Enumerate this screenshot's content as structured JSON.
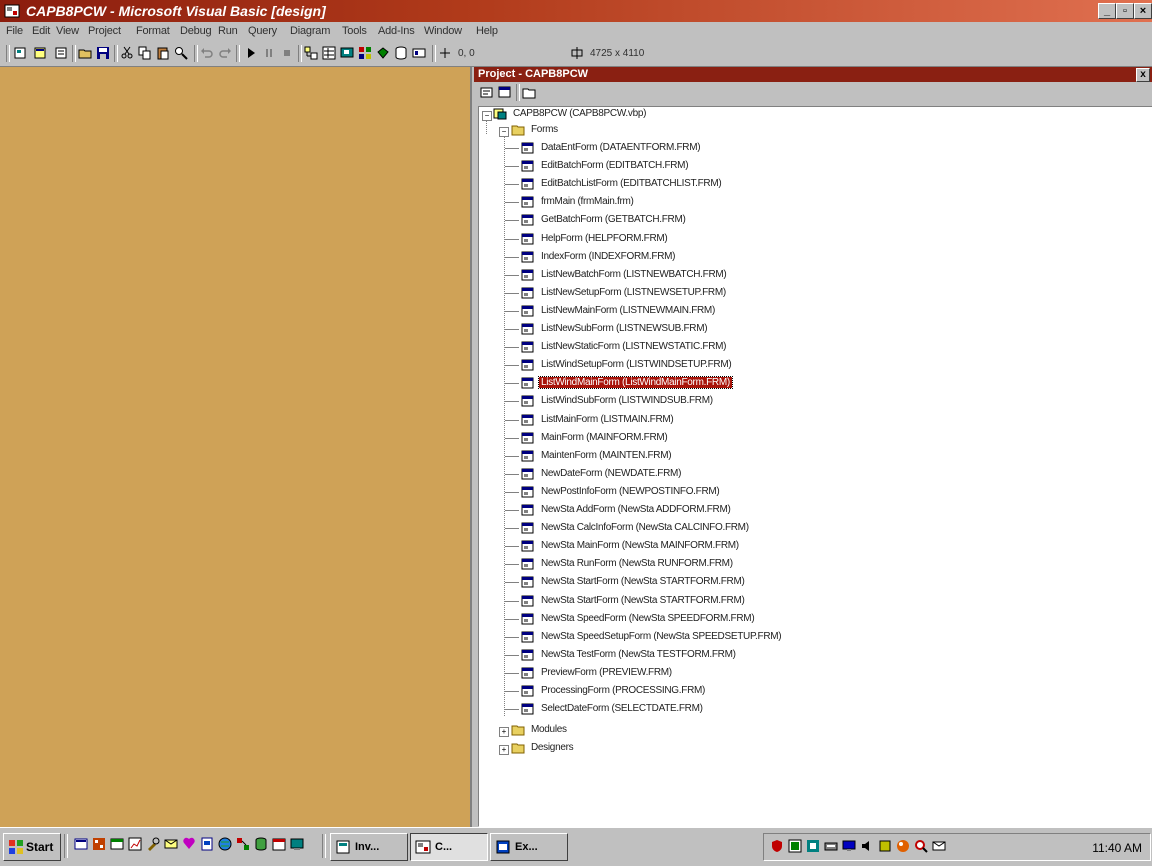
{
  "window": {
    "title": "CAPB8PCW - Microsoft Visual Basic [design]",
    "controls": {
      "minimize": "_",
      "restore": "▫",
      "close": "×"
    }
  },
  "menu": [
    "File",
    "Edit",
    "View",
    "Project",
    "Format",
    "Debug",
    "Run",
    "Query",
    "Diagram",
    "Tools",
    "Add-Ins",
    "Window",
    "Help"
  ],
  "toolbar": {
    "position": "0, 0",
    "size": "4725 x 4110"
  },
  "project": {
    "title": "Project - CAPB8PCW",
    "close": "x",
    "root": "CAPB8PCW (CAPB8PCW.vbp)",
    "forms_folder": "Forms",
    "forms": [
      "DataEntForm (DATAENTFORM.FRM)",
      "EditBatchForm (EDITBATCH.FRM)",
      "EditBatchListForm (EDITBATCHLIST.FRM)",
      "frmMain (frmMain.frm)",
      "GetBatchForm (GETBATCH.FRM)",
      "HelpForm (HELPFORM.FRM)",
      "IndexForm (INDEXFORM.FRM)",
      "ListNewBatchForm (LISTNEWBATCH.FRM)",
      "ListNewSetupForm (LISTNEWSETUP.FRM)",
      "ListNewMainForm (LISTNEWMAIN.FRM)",
      "ListNewSubForm (LISTNEWSUB.FRM)",
      "ListNewStaticForm (LISTNEWSTATIC.FRM)",
      "ListWindSetupForm (LISTWINDSETUP.FRM)",
      "ListWindMainForm (ListWindMainForm.FRM)",
      "ListWindSubForm (LISTWINDSUB.FRM)",
      "ListMainForm (LISTMAIN.FRM)",
      "MainForm (MAINFORM.FRM)",
      "MaintenForm (MAINTEN.FRM)",
      "NewDateForm (NEWDATE.FRM)",
      "NewPostInfoForm (NEWPOSTINFO.FRM)",
      "NewSta AddForm (NewSta ADDFORM.FRM)",
      "NewSta CalcInfoForm (NewSta CALCINFO.FRM)",
      "NewSta MainForm (NewSta MAINFORM.FRM)",
      "NewSta RunForm (NewSta RUNFORM.FRM)",
      "NewSta StartForm (NewSta STARTFORM.FRM)",
      "NewSta StartForm (NewSta STARTFORM.FRM)",
      "NewSta SpeedForm (NewSta SPEEDFORM.FRM)",
      "NewSta SpeedSetupForm (NewSta SPEEDSETUP.FRM)",
      "NewSta TestForm (NewSta TESTFORM.FRM)",
      "PreviewForm (PREVIEW.FRM)",
      "ProcessingForm (PROCESSING.FRM)",
      "SelectDateForm (SELECTDATE.FRM)"
    ],
    "selected_index": 13,
    "other_folders": [
      "Modules",
      "Designers"
    ]
  },
  "taskbar": {
    "start": "Start",
    "tasks": [
      {
        "label": "Inv...",
        "active": false
      },
      {
        "label": "C...",
        "active": true
      },
      {
        "label": "Ex...",
        "active": false
      }
    ],
    "clock": "11:40 AM"
  },
  "colors": {
    "title_bar": "#8b1d0e",
    "designer_background": "#cfa257",
    "selection": "#a8140a"
  }
}
